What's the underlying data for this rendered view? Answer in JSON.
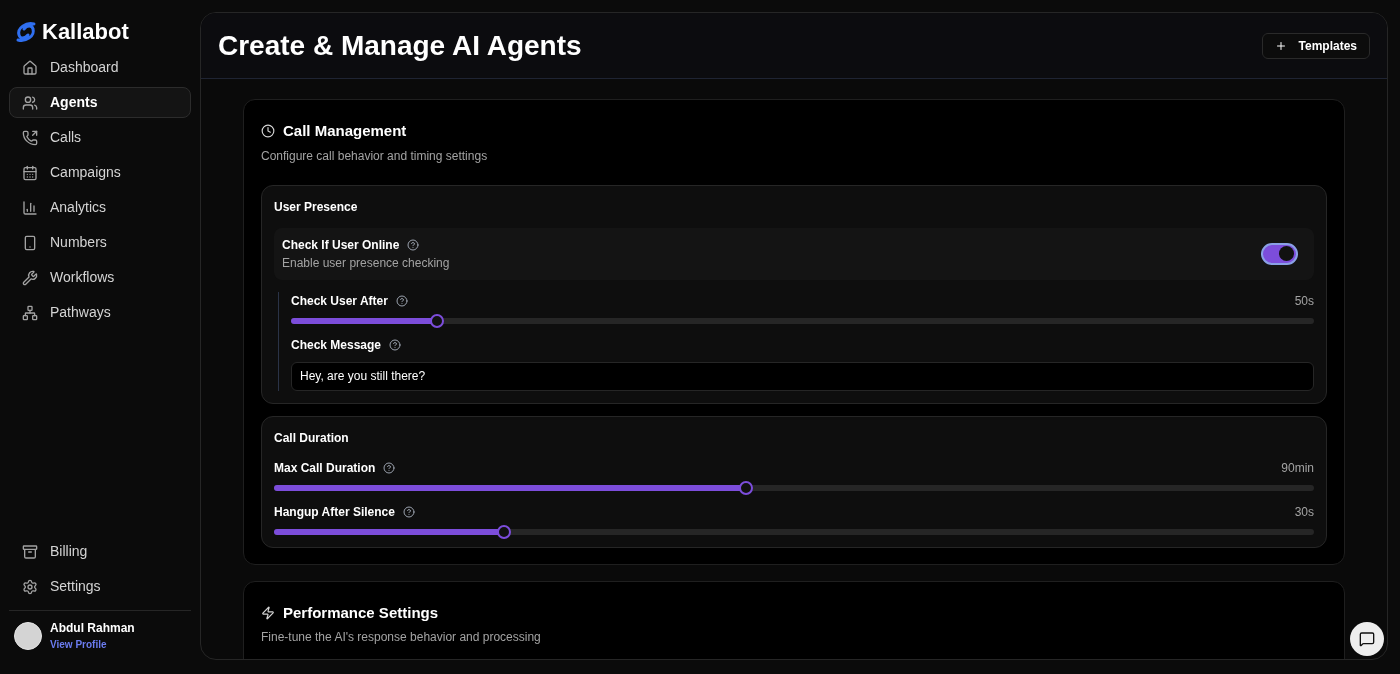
{
  "brand": {
    "name": "Kallabot"
  },
  "sidebar": {
    "items": [
      {
        "label": "Dashboard",
        "selected": false
      },
      {
        "label": "Agents",
        "selected": true
      },
      {
        "label": "Calls",
        "selected": false
      },
      {
        "label": "Campaigns",
        "selected": false
      },
      {
        "label": "Analytics",
        "selected": false
      },
      {
        "label": "Numbers",
        "selected": false
      },
      {
        "label": "Workflows",
        "selected": false
      },
      {
        "label": "Pathways",
        "selected": false
      }
    ],
    "bottom_items": [
      {
        "label": "Billing",
        "selected": false
      },
      {
        "label": "Settings",
        "selected": false
      }
    ],
    "user": {
      "name": "Abdul Rahman",
      "link": "View Profile"
    }
  },
  "header": {
    "title": "Create & Manage AI Agents",
    "button": "Templates"
  },
  "sections": [
    {
      "title": "Call Management",
      "subtitle": "Configure call behavior and timing settings",
      "groups": [
        {
          "title": "User Presence",
          "toggle": {
            "label": "Check If User Online",
            "description": "Enable user presence checking",
            "on": true
          },
          "fields": [
            {
              "kind": "slider",
              "label": "Check User After",
              "reading": "50s",
              "level": 0.143
            },
            {
              "kind": "text",
              "label": "Check Message",
              "value": "Hey, are you still there?"
            }
          ]
        },
        {
          "title": "Call Duration",
          "fields": [
            {
              "kind": "slider",
              "label": "Max Call Duration",
              "reading": "90min",
              "level": 0.454
            },
            {
              "kind": "slider",
              "label": "Hangup After Silence",
              "reading": "30s",
              "level": 0.221
            }
          ]
        }
      ]
    },
    {
      "title": "Performance Settings",
      "subtitle": "Fine-tune the AI's response behavior and processing"
    }
  ]
}
